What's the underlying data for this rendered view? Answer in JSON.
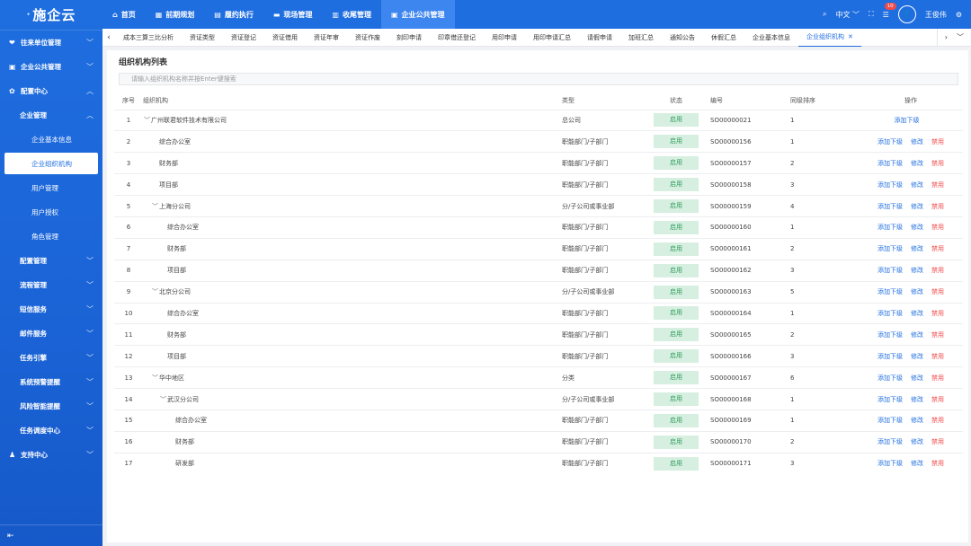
{
  "app": {
    "logo": "施企云"
  },
  "sidebar": {
    "items": [
      {
        "label": "往来单位管理",
        "icon": "handshake-icon",
        "level": 1,
        "arrow": "﹀"
      },
      {
        "label": "企业公共管理",
        "icon": "building-icon",
        "level": 1,
        "arrow": "﹀"
      },
      {
        "label": "配置中心",
        "icon": "gear-icon",
        "level": 1,
        "arrow": "︿"
      },
      {
        "label": "企业管理",
        "level": 2,
        "arrow": "︿"
      },
      {
        "label": "企业基本信息",
        "level": 3
      },
      {
        "label": "企业组织机构",
        "level": 3,
        "active": true
      },
      {
        "label": "用户管理",
        "level": 3
      },
      {
        "label": "用户授权",
        "level": 3
      },
      {
        "label": "角色管理",
        "level": 3
      },
      {
        "label": "配置管理",
        "level": 2,
        "arrow": "﹀"
      },
      {
        "label": "流程管理",
        "level": 2,
        "arrow": "﹀"
      },
      {
        "label": "短信服务",
        "level": 2,
        "arrow": "﹀"
      },
      {
        "label": "邮件服务",
        "level": 2,
        "arrow": "﹀"
      },
      {
        "label": "任务引擎",
        "level": 2,
        "arrow": "﹀"
      },
      {
        "label": "系统预警提醒",
        "level": 2,
        "arrow": "﹀"
      },
      {
        "label": "风险智能提醒",
        "level": 2,
        "arrow": "﹀"
      },
      {
        "label": "任务调度中心",
        "level": 2,
        "arrow": "﹀"
      },
      {
        "label": "支持中心",
        "icon": "user-icon",
        "level": 1,
        "arrow": "﹀"
      }
    ],
    "footer_icon": "collapse-icon"
  },
  "topnav": {
    "items": [
      {
        "label": "首页",
        "icon": "home-icon"
      },
      {
        "label": "前期规划",
        "icon": "calendar-icon"
      },
      {
        "label": "履约执行",
        "icon": "clipboard-icon"
      },
      {
        "label": "现场管理",
        "icon": "folder-icon"
      },
      {
        "label": "收尾管理",
        "icon": "archive-icon"
      },
      {
        "label": "企业公共管理",
        "icon": "building-icon",
        "active": true
      }
    ],
    "language": "中文",
    "notification_count": "10",
    "user_name": "王俊伟"
  },
  "tabs": {
    "items": [
      "成本三算三比分析",
      "资证类型",
      "资证登记",
      "资证借用",
      "资证年审",
      "资证作废",
      "刻印申请",
      "印章借还登记",
      "用印申请",
      "用印申请汇总",
      "请假申请",
      "加班汇总",
      "通知公告",
      "休假汇总",
      "企业基本信息"
    ],
    "active": "企业组织机构",
    "close": "✕"
  },
  "page": {
    "title": "组织机构列表",
    "search_placeholder": "请输入组织机构名称并按Enter键搜索"
  },
  "table": {
    "headers": {
      "no": "序号",
      "org": "组织机构",
      "type": "类型",
      "status": "状态",
      "code": "编号",
      "sort": "同级排序",
      "ops": "操作"
    },
    "actions": {
      "add": "添加下级",
      "edit": "修改",
      "disable": "禁用"
    },
    "rows": [
      {
        "no": "1",
        "indent": 0,
        "expand": "﹀",
        "name": "广州联君软件技术有限公司",
        "type": "总公司",
        "status": "启用",
        "code": "SO00000021",
        "sort": "1",
        "root": true
      },
      {
        "no": "2",
        "indent": 1,
        "expand": "",
        "name": "综合办公室",
        "type": "职能部门/子部门",
        "status": "启用",
        "code": "SO00000156",
        "sort": "1"
      },
      {
        "no": "3",
        "indent": 1,
        "expand": "",
        "name": "财务部",
        "type": "职能部门/子部门",
        "status": "启用",
        "code": "SO00000157",
        "sort": "2"
      },
      {
        "no": "4",
        "indent": 1,
        "expand": "",
        "name": "项目部",
        "type": "职能部门/子部门",
        "status": "启用",
        "code": "SO00000158",
        "sort": "3"
      },
      {
        "no": "5",
        "indent": 1,
        "expand": "﹀",
        "name": "上海分公司",
        "type": "分/子公司或事业部",
        "status": "启用",
        "code": "SO00000159",
        "sort": "4"
      },
      {
        "no": "6",
        "indent": 2,
        "expand": "",
        "name": "综合办公室",
        "type": "职能部门/子部门",
        "status": "启用",
        "code": "SO00000160",
        "sort": "1"
      },
      {
        "no": "7",
        "indent": 2,
        "expand": "",
        "name": "财务部",
        "type": "职能部门/子部门",
        "status": "启用",
        "code": "SO00000161",
        "sort": "2"
      },
      {
        "no": "8",
        "indent": 2,
        "expand": "",
        "name": "项目部",
        "type": "职能部门/子部门",
        "status": "启用",
        "code": "SO00000162",
        "sort": "3"
      },
      {
        "no": "9",
        "indent": 1,
        "expand": "﹀",
        "name": "北京分公司",
        "type": "分/子公司或事业部",
        "status": "启用",
        "code": "SO00000163",
        "sort": "5"
      },
      {
        "no": "10",
        "indent": 2,
        "expand": "",
        "name": "综合办公室",
        "type": "职能部门/子部门",
        "status": "启用",
        "code": "SO00000164",
        "sort": "1"
      },
      {
        "no": "11",
        "indent": 2,
        "expand": "",
        "name": "财务部",
        "type": "职能部门/子部门",
        "status": "启用",
        "code": "SO00000165",
        "sort": "2"
      },
      {
        "no": "12",
        "indent": 2,
        "expand": "",
        "name": "项目部",
        "type": "职能部门/子部门",
        "status": "启用",
        "code": "SO00000166",
        "sort": "3"
      },
      {
        "no": "13",
        "indent": 1,
        "expand": "﹀",
        "name": "华中地区",
        "type": "分类",
        "status": "启用",
        "code": "SO00000167",
        "sort": "6"
      },
      {
        "no": "14",
        "indent": 2,
        "expand": "﹀",
        "name": "武汉分公司",
        "type": "分/子公司或事业部",
        "status": "启用",
        "code": "SO00000168",
        "sort": "1"
      },
      {
        "no": "15",
        "indent": 3,
        "expand": "",
        "name": "综合办公室",
        "type": "职能部门/子部门",
        "status": "启用",
        "code": "SO00000169",
        "sort": "1"
      },
      {
        "no": "16",
        "indent": 3,
        "expand": "",
        "name": "财务部",
        "type": "职能部门/子部门",
        "status": "启用",
        "code": "SO00000170",
        "sort": "2"
      },
      {
        "no": "17",
        "indent": 3,
        "expand": "",
        "name": "研发部",
        "type": "职能部门/子部门",
        "status": "启用",
        "code": "SO00000171",
        "sort": "3"
      }
    ]
  },
  "colors": {
    "primary": "#1f6ee0",
    "danger": "#f04b4b",
    "success_bg": "#d7efe0",
    "success_text": "#2c9c5c"
  }
}
